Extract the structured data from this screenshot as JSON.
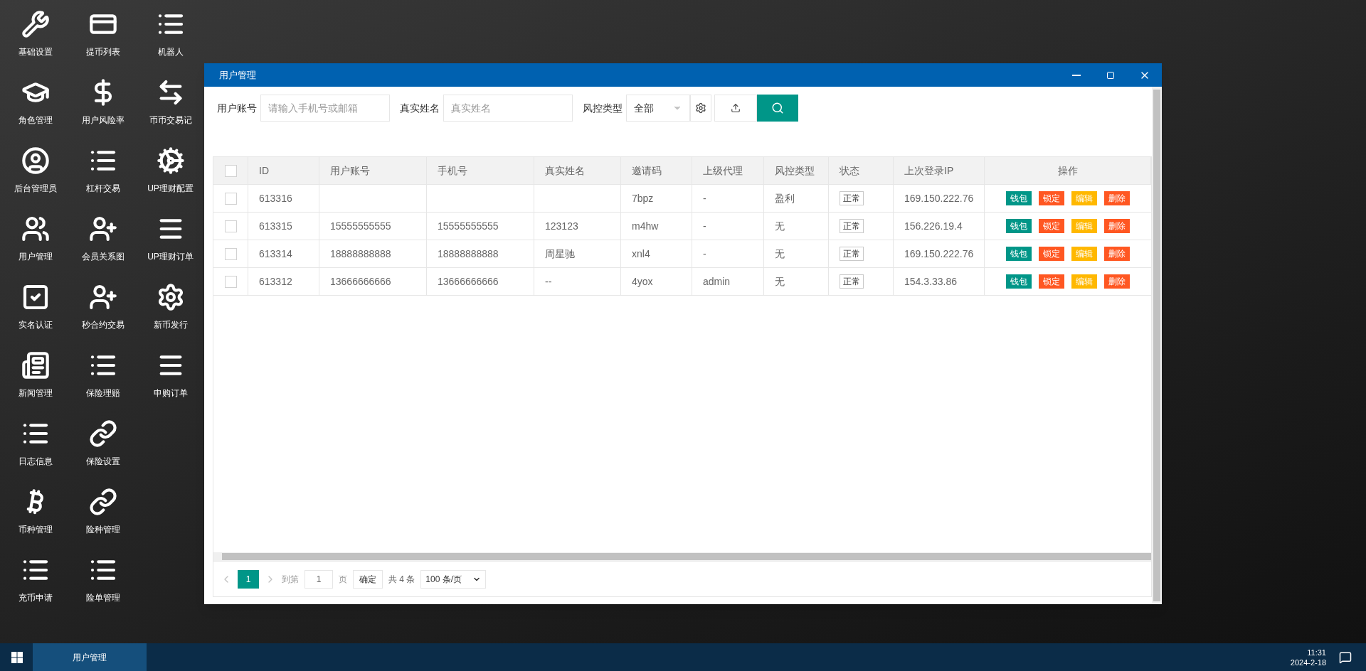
{
  "desktop_columns": [
    [
      {
        "label": "基础设置",
        "kind": "wrench"
      },
      {
        "label": "角色管理",
        "kind": "cap"
      },
      {
        "label": "后台管理员",
        "kind": "user-circle"
      },
      {
        "label": "用户管理",
        "kind": "users"
      },
      {
        "label": "实名认证",
        "kind": "check"
      },
      {
        "label": "新闻管理",
        "kind": "news"
      },
      {
        "label": "日志信息",
        "kind": "list"
      },
      {
        "label": "币种管理",
        "kind": "bitcoin"
      },
      {
        "label": "充币申请",
        "kind": "list"
      }
    ],
    [
      {
        "label": "提币列表",
        "kind": "card"
      },
      {
        "label": "用户风险率",
        "kind": "dollar"
      },
      {
        "label": "杠杆交易",
        "kind": "list"
      },
      {
        "label": "会员关系图",
        "kind": "user-plus"
      },
      {
        "label": "秒合约交易",
        "kind": "user-plus"
      },
      {
        "label": "保险理赔",
        "kind": "list"
      },
      {
        "label": "保险设置",
        "kind": "link"
      },
      {
        "label": "险种管理",
        "kind": "link"
      },
      {
        "label": "险单管理",
        "kind": "list"
      }
    ],
    [
      {
        "label": "机器人",
        "kind": "list"
      },
      {
        "label": "币币交易记",
        "kind": "arrows"
      },
      {
        "label": "UP理财配置",
        "kind": "gears"
      },
      {
        "label": "UP理财订单",
        "kind": "bars"
      },
      {
        "label": "新币发行",
        "kind": "gear"
      },
      {
        "label": "申购订单",
        "kind": "bars"
      }
    ]
  ],
  "window": {
    "title": "用户管理"
  },
  "filters": {
    "account_label": "用户账号",
    "account_placeholder": "请输入手机号或邮箱",
    "name_label": "真实姓名",
    "name_placeholder": "真实姓名",
    "risk_label": "风控类型",
    "risk_value": "全部"
  },
  "table": {
    "select_all_checked": false,
    "columns": [
      "ID",
      "用户账号",
      "手机号",
      "真实姓名",
      "邀请码",
      "上级代理",
      "风控类型",
      "状态",
      "上次登录IP",
      "操作"
    ],
    "rows": [
      {
        "checked": false,
        "id": "613316",
        "account": "",
        "phone": "",
        "real_name": "",
        "invite_code": "7bpz",
        "agent": "-",
        "risk_type": "盈利",
        "status": "正常",
        "last_ip": "169.150.222.76",
        "actions": [
          {
            "label": "钱包",
            "kind": "wallet"
          },
          {
            "label": "锁定",
            "kind": "lock"
          },
          {
            "label": "编辑",
            "kind": "edit"
          },
          {
            "label": "删除",
            "kind": "delete"
          }
        ]
      },
      {
        "checked": false,
        "id": "613315",
        "account": "15555555555",
        "phone": "15555555555",
        "real_name": "123123",
        "invite_code": "m4hw",
        "agent": "-",
        "risk_type": "无",
        "status": "正常",
        "last_ip": "156.226.19.4",
        "actions": [
          {
            "label": "钱包",
            "kind": "wallet"
          },
          {
            "label": "锁定",
            "kind": "lock"
          },
          {
            "label": "编辑",
            "kind": "edit"
          },
          {
            "label": "删除",
            "kind": "delete"
          }
        ]
      },
      {
        "checked": false,
        "id": "613314",
        "account": "18888888888",
        "phone": "18888888888",
        "real_name": "周星驰",
        "invite_code": "xnl4",
        "agent": "-",
        "risk_type": "无",
        "status": "正常",
        "last_ip": "169.150.222.76",
        "actions": [
          {
            "label": "钱包",
            "kind": "wallet"
          },
          {
            "label": "锁定",
            "kind": "lock"
          },
          {
            "label": "编辑",
            "kind": "edit"
          },
          {
            "label": "删除",
            "kind": "delete"
          }
        ]
      },
      {
        "checked": false,
        "id": "613312",
        "account": "13666666666",
        "phone": "13666666666",
        "real_name": "--",
        "invite_code": "4yox",
        "agent": "admin",
        "risk_type": "无",
        "status": "正常",
        "last_ip": "154.3.33.86",
        "actions": [
          {
            "label": "钱包",
            "kind": "wallet"
          },
          {
            "label": "锁定",
            "kind": "lock"
          },
          {
            "label": "编辑",
            "kind": "edit"
          },
          {
            "label": "删除",
            "kind": "delete"
          }
        ]
      }
    ]
  },
  "pagination": {
    "pages": [
      {
        "label": "1",
        "selected": true
      }
    ],
    "goto_label": "到第",
    "goto_value": "1",
    "page_unit": "页",
    "confirm": "确定",
    "total": "共 4 条",
    "page_size": "100 条/页"
  },
  "taskbar": {
    "tasks": [
      {
        "label": "用户管理",
        "selected": true
      }
    ],
    "time": "11:31",
    "date": "2024-2-18"
  }
}
